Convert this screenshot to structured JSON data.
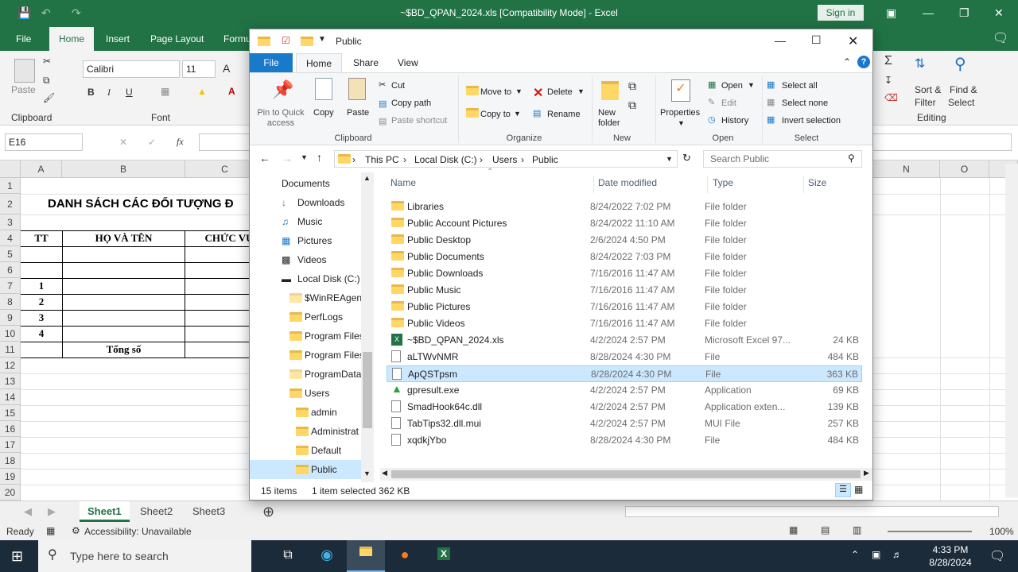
{
  "excel": {
    "title": "~$BD_QPAN_2024.xls  [Compatibility Mode]  -  Excel",
    "sign_in": "Sign in",
    "tabs": [
      "File",
      "Home",
      "Insert",
      "Page Layout",
      "Formu"
    ],
    "font_name": "Calibri",
    "font_size": "11",
    "clipboard_label": "Clipboard",
    "font_label": "Font",
    "paste_label": "Paste",
    "editing_label": "Editing",
    "sort_label": "Sort &",
    "filter_label": "Filter",
    "find_label": "Find &",
    "select_label": "Select",
    "name_box": "E16",
    "fx": "fx",
    "col_headers": [
      "A",
      "B",
      "C",
      "N",
      "O"
    ],
    "rows": [
      "1",
      "2",
      "3",
      "4",
      "5",
      "6",
      "7",
      "8",
      "9",
      "10",
      "11",
      "12",
      "13",
      "14",
      "15",
      "16",
      "17",
      "18",
      "19",
      "20"
    ],
    "sheet_title": "DANH SÁCH CÁC ĐỐI TƯỢNG Đ",
    "hdr_tt": "TT",
    "hdr_name": "HỌ VÀ TÊN",
    "hdr_role": "CHỨC VỤ",
    "numbers": [
      "1",
      "2",
      "3",
      "4"
    ],
    "total": "Tổng số",
    "sheets": [
      "Sheet1",
      "Sheet2",
      "Sheet3"
    ],
    "status_ready": "Ready",
    "accessibility": "Accessibility: Unavailable",
    "zoom": "100%"
  },
  "explorer": {
    "title": "Public",
    "tabs": [
      "File",
      "Home",
      "Share",
      "View"
    ],
    "ribbon": {
      "pin": "Pin to Quick access",
      "copy": "Copy",
      "paste": "Paste",
      "cut": "Cut",
      "copy_path": "Copy path",
      "paste_shortcut": "Paste shortcut",
      "move_to": "Move to",
      "copy_to": "Copy to",
      "delete": "Delete",
      "rename": "Rename",
      "new_folder": "New folder",
      "properties": "Properties",
      "open": "Open",
      "edit": "Edit",
      "history": "History",
      "select_all": "Select all",
      "select_none": "Select none",
      "invert_selection": "Invert selection",
      "groups": [
        "Clipboard",
        "Organize",
        "New",
        "Open",
        "Select"
      ]
    },
    "breadcrumb": [
      "This PC",
      "Local Disk (C:)",
      "Users",
      "Public"
    ],
    "search_placeholder": "Search Public",
    "nav": [
      "Documents",
      "Downloads",
      "Music",
      "Pictures",
      "Videos",
      "Local Disk (C:)",
      "$WinREAgent",
      "PerfLogs",
      "Program Files",
      "Program Files",
      "ProgramData",
      "Users",
      "admin",
      "Administrat",
      "Default",
      "Public"
    ],
    "columns": [
      "Name",
      "Date modified",
      "Type",
      "Size"
    ],
    "files": [
      {
        "name": "Libraries",
        "date": "8/24/2022 7:02 PM",
        "type": "File folder",
        "size": ""
      },
      {
        "name": "Public Account Pictures",
        "date": "8/24/2022 11:10 AM",
        "type": "File folder",
        "size": ""
      },
      {
        "name": "Public Desktop",
        "date": "2/6/2024 4:50 PM",
        "type": "File folder",
        "size": ""
      },
      {
        "name": "Public Documents",
        "date": "8/24/2022 7:03 PM",
        "type": "File folder",
        "size": ""
      },
      {
        "name": "Public Downloads",
        "date": "7/16/2016 11:47 AM",
        "type": "File folder",
        "size": ""
      },
      {
        "name": "Public Music",
        "date": "7/16/2016 11:47 AM",
        "type": "File folder",
        "size": ""
      },
      {
        "name": "Public Pictures",
        "date": "7/16/2016 11:47 AM",
        "type": "File folder",
        "size": ""
      },
      {
        "name": "Public Videos",
        "date": "7/16/2016 11:47 AM",
        "type": "File folder",
        "size": ""
      },
      {
        "name": "~$BD_QPAN_2024.xls",
        "date": "4/2/2024 2:57 PM",
        "type": "Microsoft Excel 97...",
        "size": "24 KB"
      },
      {
        "name": "aLTWvNMR",
        "date": "8/28/2024 4:30 PM",
        "type": "File",
        "size": "484 KB"
      },
      {
        "name": "ApQSTpsm",
        "date": "8/28/2024 4:30 PM",
        "type": "File",
        "size": "363 KB"
      },
      {
        "name": "gpresult.exe",
        "date": "4/2/2024 2:57 PM",
        "type": "Application",
        "size": "69 KB"
      },
      {
        "name": "SmadHook64c.dll",
        "date": "4/2/2024 2:57 PM",
        "type": "Application exten...",
        "size": "139 KB"
      },
      {
        "name": "TabTips32.dll.mui",
        "date": "4/2/2024 2:57 PM",
        "type": "MUI File",
        "size": "257 KB"
      },
      {
        "name": "xqdkjYbo",
        "date": "8/28/2024 4:30 PM",
        "type": "File",
        "size": "484 KB"
      }
    ],
    "status_items": "15 items",
    "status_selected": "1 item selected  362 KB"
  },
  "taskbar": {
    "search_placeholder": "Type here to search",
    "time": "4:33 PM",
    "date": "8/28/2024"
  },
  "colors": {
    "excel_green": "#217346",
    "selection": "#cce8ff",
    "accent": "#1979ca"
  }
}
